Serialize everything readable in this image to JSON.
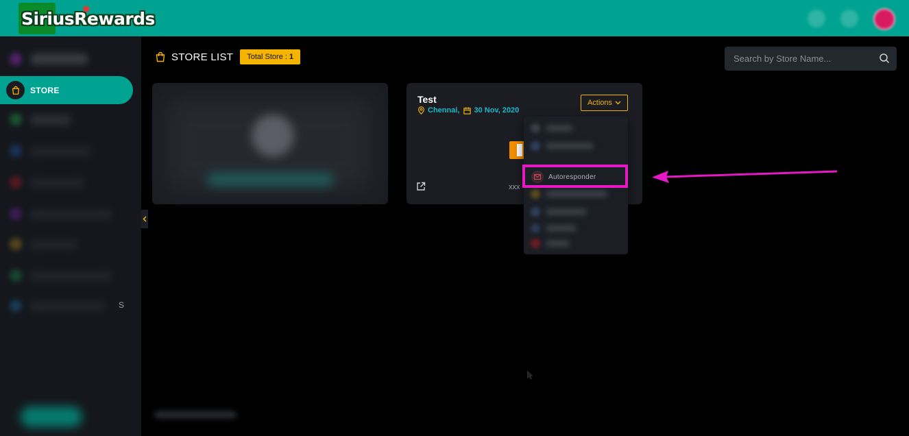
{
  "header": {
    "brand": "SiriusRewards",
    "brand_star": "✸"
  },
  "sidebar": {
    "active_label": "STORE",
    "fragment_text": "S"
  },
  "main": {
    "title": "STORE LIST",
    "badge_label": "Total Store : ",
    "badge_count": "1",
    "search_placeholder": "Search by Store Name..."
  },
  "store_card": {
    "name": "Test",
    "city": "Chennai,",
    "date": "30 Nov, 2020",
    "actions_label": "Actions",
    "code": "xxx"
  },
  "dropdown": {
    "highlighted_item": "Autoresponder"
  },
  "colors": {
    "teal": "#00a391",
    "accent": "#f5b400",
    "highlight": "#e619c6",
    "info": "#19b8c8"
  }
}
